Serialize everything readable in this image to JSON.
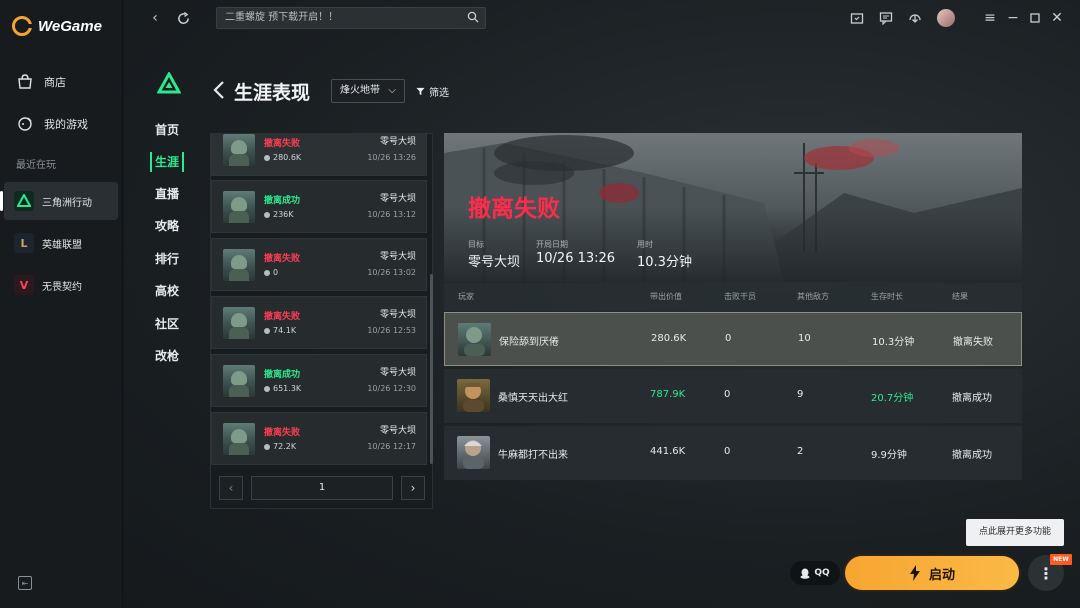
{
  "app": {
    "logo_text": "WeGame"
  },
  "sidebar": {
    "nav": [
      {
        "label": "商店",
        "icon": "store-icon"
      },
      {
        "label": "我的游戏",
        "icon": "my-games-icon"
      }
    ],
    "recent_label": "最近在玩",
    "games": [
      {
        "label": "三角洲行动",
        "icon": "delta-force-icon",
        "active": true
      },
      {
        "label": "英雄联盟",
        "icon": "league-of-legends-icon",
        "active": false
      },
      {
        "label": "无畏契约",
        "icon": "valorant-icon",
        "active": false
      }
    ]
  },
  "topbar": {
    "search_text": "二重螺旋  预下载开启！！"
  },
  "subnav": [
    {
      "label": "首页",
      "active": false
    },
    {
      "label": "生涯",
      "active": true
    },
    {
      "label": "直播",
      "active": false
    },
    {
      "label": "攻略",
      "active": false
    },
    {
      "label": "排行",
      "active": false
    },
    {
      "label": "高校",
      "active": false
    },
    {
      "label": "社区",
      "active": false
    },
    {
      "label": "改枪",
      "active": false
    }
  ],
  "page": {
    "title": "生涯表现",
    "map_select": "烽火地带",
    "filter_label": "筛选"
  },
  "matches": [
    {
      "result": "撤离失败",
      "status": "fail",
      "value": "280.6K",
      "map": "零号大坝",
      "time": "10/26 13:26"
    },
    {
      "result": "撤离成功",
      "status": "success",
      "value": "236K",
      "map": "零号大坝",
      "time": "10/26 13:12"
    },
    {
      "result": "撤离失败",
      "status": "fail",
      "value": "0",
      "map": "零号大坝",
      "time": "10/26 13:02"
    },
    {
      "result": "撤离失败",
      "status": "fail",
      "value": "74.1K",
      "map": "零号大坝",
      "time": "10/26 12:53"
    },
    {
      "result": "撤离成功",
      "status": "success",
      "value": "651.3K",
      "map": "零号大坝",
      "time": "10/26 12:30"
    },
    {
      "result": "撤离失败",
      "status": "fail",
      "value": "72.2K",
      "map": "零号大坝",
      "time": "10/26 12:17"
    }
  ],
  "pager": {
    "page": "1"
  },
  "detail": {
    "result": "撤离失败",
    "stats": [
      {
        "label": "目标",
        "value": "零号大坝"
      },
      {
        "label": "开局日期",
        "value": "10/26 13:26"
      },
      {
        "label": "用时",
        "value": "10.3分钟"
      }
    ],
    "columns": [
      "玩家",
      "带出价值",
      "击败干员",
      "其他敌方",
      "生存时长",
      "结果"
    ],
    "players": [
      {
        "name": "保险舔到厌倦",
        "value": "280.6K",
        "kills": "0",
        "others": "10",
        "survival": "10.3分钟",
        "result": "撤离失败",
        "highlight": true,
        "green": false
      },
      {
        "name": "桑慎天天出大红",
        "value": "787.9K",
        "kills": "0",
        "others": "9",
        "survival": "20.7分钟",
        "result": "撤离成功",
        "highlight": false,
        "green": true
      },
      {
        "name": "牛麻都打不出来",
        "value": "441.6K",
        "kills": "0",
        "others": "2",
        "survival": "9.9分钟",
        "result": "撤离成功",
        "highlight": false,
        "green": false
      }
    ]
  },
  "bottom": {
    "tooltip": "点此展开更多功能",
    "qq_label": "QQ",
    "launch_label": "启动",
    "new_badge": "NEW"
  },
  "colors": {
    "accent_green": "#2ee88f",
    "fail_red": "#ff3d55",
    "launch_orange": "#f7a531"
  }
}
